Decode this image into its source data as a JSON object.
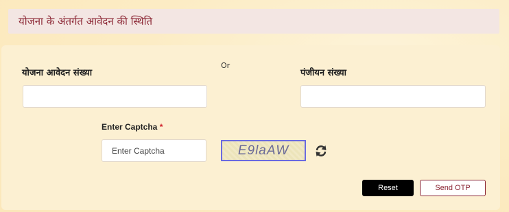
{
  "header": {
    "title": "योजना के अंतर्गत आवेदन की स्थिति"
  },
  "form": {
    "application_number": {
      "label": "योजना आवेदन संख्या",
      "value": ""
    },
    "or_label": "Or",
    "registration_number": {
      "label": "पंजीयन संख्या",
      "value": ""
    },
    "captcha": {
      "label": "Enter Captcha",
      "required_marker": "*",
      "placeholder": "Enter Captcha",
      "image_text": "E9laAW",
      "refresh_icon": "refresh-icon"
    }
  },
  "actions": {
    "reset_label": "Reset",
    "send_otp_label": "Send OTP"
  },
  "colors": {
    "title_text": "#8a2432",
    "accent": "#8a2432",
    "reset_bg": "#000000",
    "captcha_border": "#6a6ae0"
  }
}
